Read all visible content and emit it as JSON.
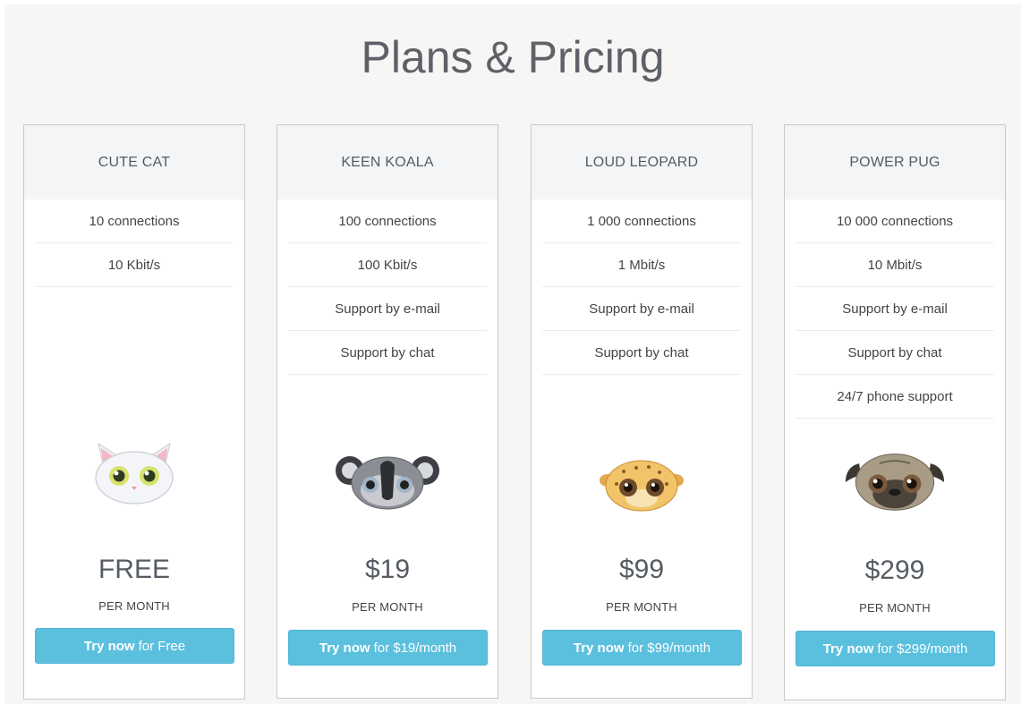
{
  "page": {
    "title": "Plans & Pricing"
  },
  "plans": [
    {
      "name": "CUTE CAT",
      "features": [
        "10 connections",
        "10 Kbit/s"
      ],
      "mascot": "cat-icon",
      "price": "FREE",
      "period": "PER MONTH",
      "button": {
        "strong": "Try now",
        "rest": "for Free"
      }
    },
    {
      "name": "KEEN KOALA",
      "features": [
        "100 connections",
        "100 Kbit/s",
        "Support by e-mail",
        "Support by chat"
      ],
      "mascot": "koala-icon",
      "price": "$19",
      "period": "PER MONTH",
      "button": {
        "strong": "Try now",
        "rest": "for $19/month"
      }
    },
    {
      "name": "LOUD LEOPARD",
      "features": [
        "1 000 connections",
        "1 Mbit/s",
        "Support by e-mail",
        "Support by chat"
      ],
      "mascot": "leopard-icon",
      "price": "$99",
      "period": "PER MONTH",
      "button": {
        "strong": "Try now",
        "rest": "for $99/month"
      }
    },
    {
      "name": "POWER PUG",
      "features": [
        "10 000 connections",
        "10 Mbit/s",
        "Support by e-mail",
        "Support by chat",
        "24/7 phone support"
      ],
      "mascot": "pug-icon",
      "price": "$299",
      "period": "PER MONTH",
      "button": {
        "strong": "Try now",
        "rest": "for $299/month"
      }
    }
  ],
  "colors": {
    "accent": "#5bc0de",
    "background": "#f7f6f4",
    "header": "#f4f5f7"
  }
}
